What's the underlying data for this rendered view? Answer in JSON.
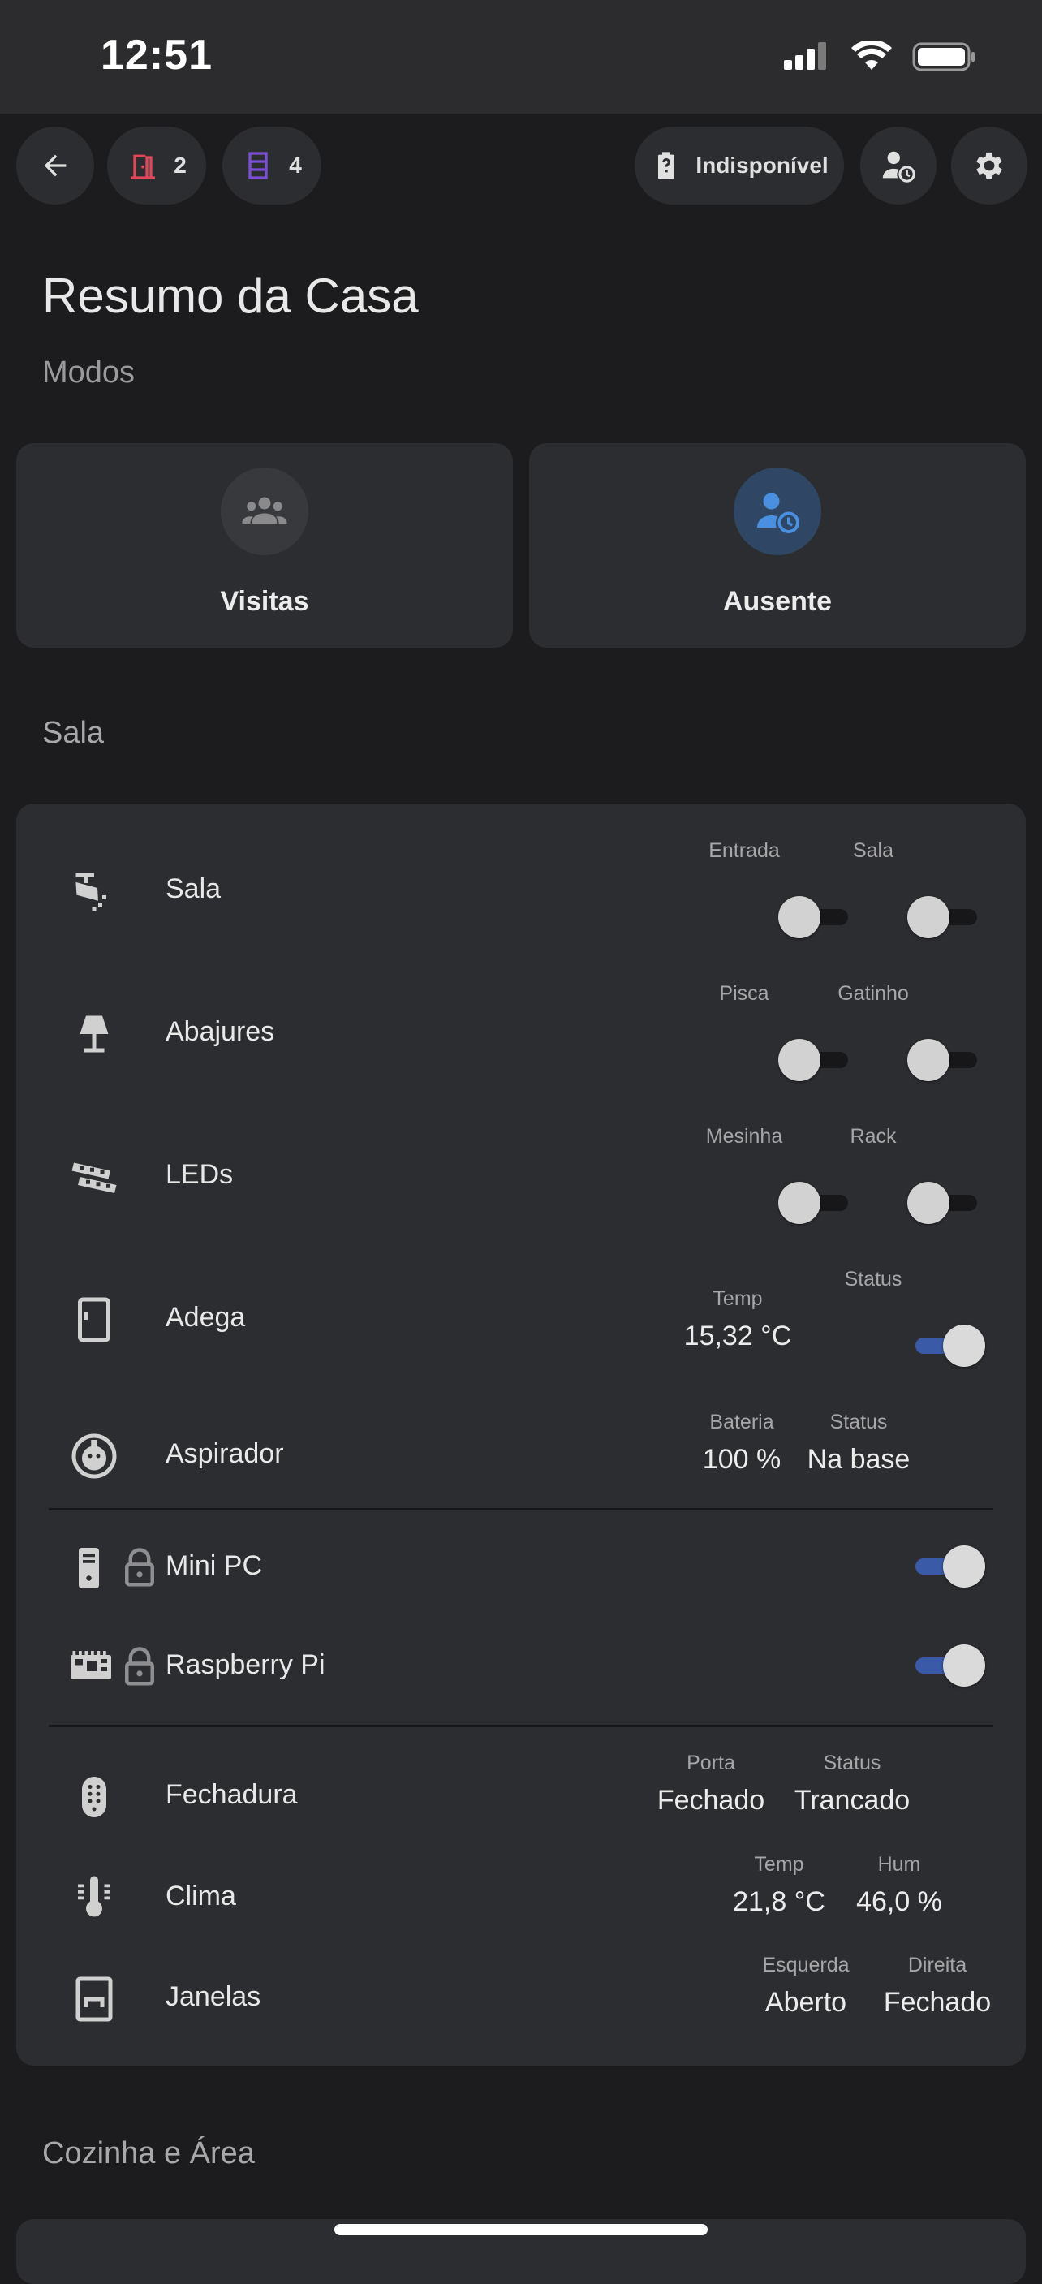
{
  "status_bar": {
    "time": "12:51"
  },
  "header": {
    "doors_count": "2",
    "windows_count": "4",
    "battery_status": "Indisponível"
  },
  "page": {
    "title": "Resumo da Casa",
    "modes_section": "Modos"
  },
  "modes": [
    {
      "label": "Visitas",
      "icon": "people-group-icon",
      "active": false
    },
    {
      "label": "Ausente",
      "icon": "person-clock-icon",
      "active": true
    }
  ],
  "sections": {
    "room": "Sala",
    "next": "Cozinha e Área"
  },
  "rows": {
    "sala": {
      "name": "Sala",
      "col1_label": "Entrada",
      "col2_label": "Sala",
      "col1_on": false,
      "col2_on": false
    },
    "abajures": {
      "name": "Abajures",
      "col1_label": "Pisca",
      "col2_label": "Gatinho",
      "col1_on": false,
      "col2_on": false
    },
    "leds": {
      "name": "LEDs",
      "col1_label": "Mesinha",
      "col2_label": "Rack",
      "col1_on": false,
      "col2_on": false
    },
    "adega": {
      "name": "Adega",
      "col1_label": "Temp",
      "col1_value": "15,32 °C",
      "col2_label": "Status",
      "col2_on": true
    },
    "aspirador": {
      "name": "Aspirador",
      "col1_label": "Bateria",
      "col1_value": "100 %",
      "col2_label": "Status",
      "col2_value": "Na base"
    },
    "mini_pc": {
      "name": "Mini PC",
      "on": true
    },
    "raspberry": {
      "name": "Raspberry Pi",
      "on": true
    },
    "fechadura": {
      "name": "Fechadura",
      "col1_label": "Porta",
      "col1_value": "Fechado",
      "col2_label": "Status",
      "col2_value": "Trancado"
    },
    "clima": {
      "name": "Clima",
      "col1_label": "Temp",
      "col1_value": "21,8 °C",
      "col2_label": "Hum",
      "col2_value": "46,0 %"
    },
    "janelas": {
      "name": "Janelas",
      "col1_label": "Esquerda",
      "col1_value": "Aberto",
      "col2_label": "Direita",
      "col2_value": "Fechado"
    }
  },
  "colors": {
    "background": "#1c1c1e",
    "card": "#2c2d30",
    "door_icon": "#e0475a",
    "window_icon": "#7a4fd6",
    "active_mode": "#4a8fe0",
    "toggle_on": "#3a5aa8"
  }
}
